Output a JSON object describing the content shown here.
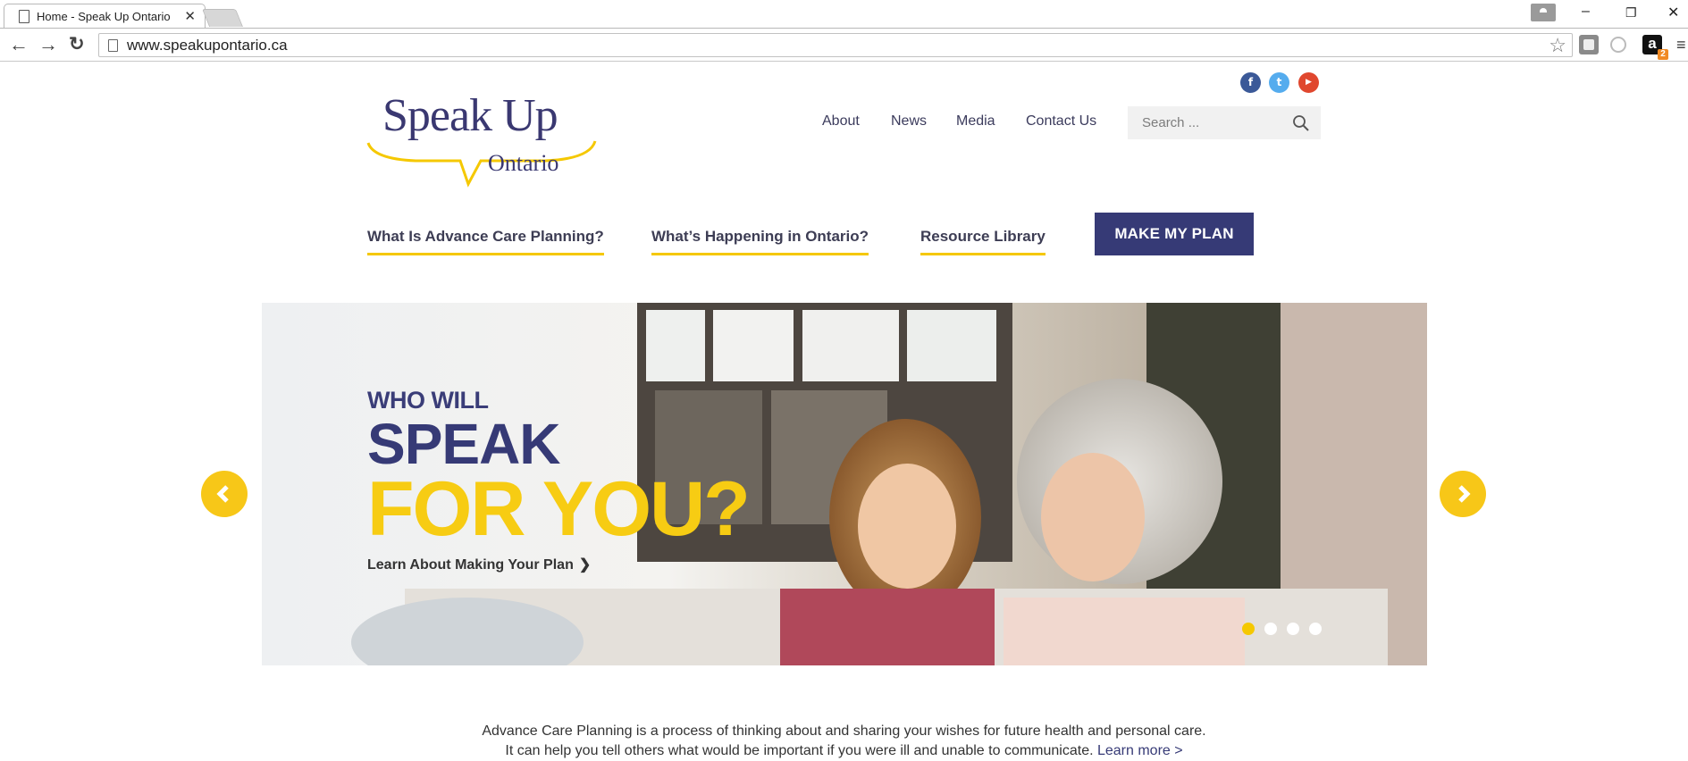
{
  "browser": {
    "tab_title": "Home - Speak Up Ontario",
    "tab_close": "✕",
    "url": "www.speakupontario.ca",
    "back": "←",
    "forward": "→",
    "reload": "↻",
    "star": "☆",
    "minimize": "–",
    "restore": "❐",
    "close": "✕",
    "amazon_label": "a",
    "amazon_badge": "2",
    "menu": "≡"
  },
  "header": {
    "social": [
      {
        "name": "facebook-icon",
        "glyph": "f"
      },
      {
        "name": "twitter-icon",
        "glyph": "t"
      },
      {
        "name": "youtube-icon",
        "glyph": "▶"
      }
    ],
    "logo": {
      "line1": "Speak Up",
      "line2": "Ontario"
    },
    "nav": [
      "About",
      "News",
      "Media",
      "Contact Us"
    ],
    "search_placeholder": "Search ..."
  },
  "section_nav": {
    "links": [
      "What Is Advance Care Planning?",
      "What’s Happening in Ontario?",
      "Resource Library"
    ],
    "cta": "MAKE MY PLAN"
  },
  "hero": {
    "line1": "WHO WILL",
    "line2": "SPEAK",
    "line3": "FOR YOU?",
    "link": "Learn About Making Your Plan",
    "link_chevron": "❯",
    "slides": 4,
    "active_slide": 1
  },
  "intro": {
    "line1": "Advance Care Planning is a process of thinking about and sharing your wishes for future health and personal care.",
    "line2": "It can help you tell others what would be important if you were ill and unable to communicate.",
    "learn_more": "Learn more >"
  },
  "colors": {
    "brand_navy": "#363a76",
    "brand_yellow": "#f5c800"
  }
}
